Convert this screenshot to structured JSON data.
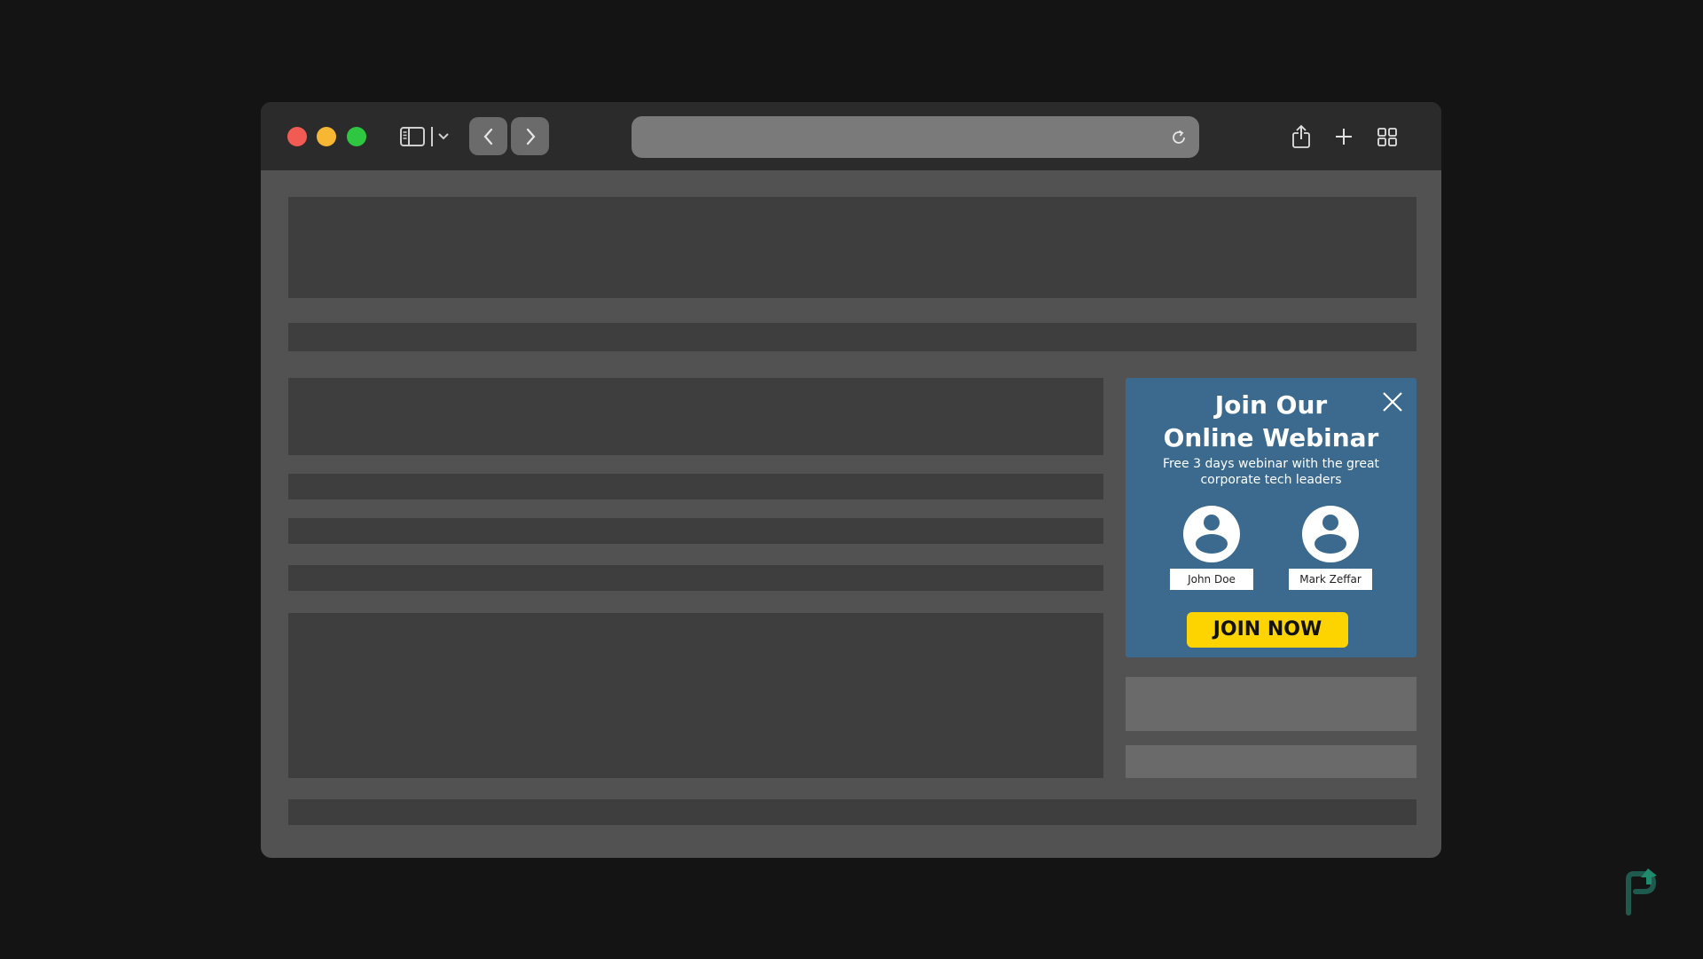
{
  "browser": {
    "address_bar": {
      "url": ""
    }
  },
  "popup": {
    "title_line1": "Join Our",
    "title_line2": "Online Webinar",
    "subtitle": "Free 3 days webinar with the great corporate tech leaders",
    "speakers": [
      {
        "name": "John Doe"
      },
      {
        "name": "Mark Zeffar"
      }
    ],
    "cta_label": "JOIN NOW",
    "colors": {
      "background": "#3b6a8e",
      "cta": "#fdd400"
    }
  },
  "icons": {
    "close": "close-icon",
    "avatar": "user-avatar-icon",
    "reload": "reload-icon",
    "share": "share-icon",
    "new_tab": "plus-icon",
    "tab_overview": "grid-icon",
    "sidebar": "sidebar-icon",
    "back": "chevron-left-icon",
    "forward": "chevron-right-icon"
  }
}
